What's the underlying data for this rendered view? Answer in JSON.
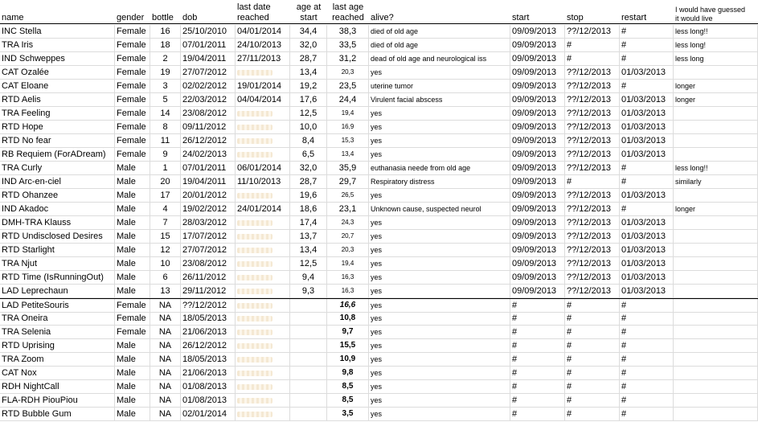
{
  "columns": {
    "name": "name",
    "gender": "gender",
    "bottle": "bottle",
    "dob": "dob",
    "last_date": "last date\nreached",
    "age_start": "age at\nstart",
    "last_age": "last age\nreached",
    "alive": "alive?",
    "start": "start",
    "stop": "stop",
    "restart": "restart",
    "guess": "I would have guessed\nit would live"
  },
  "rows": [
    {
      "name": "INC Stella",
      "gender": "Female",
      "bottle": "16",
      "dob": "25/10/2010",
      "last_date": "04/01/2014",
      "age_start": "34,4",
      "last_age": "38,3",
      "alive": "died of old age",
      "start": "09/09/2013",
      "stop": "??/12/2013",
      "restart": "#",
      "guess": "less long!!"
    },
    {
      "name": "TRA Iris",
      "gender": "Female",
      "bottle": "18",
      "dob": "07/01/2011",
      "last_date": "24/10/2013",
      "age_start": "32,0",
      "last_age": "33,5",
      "alive": "died of old age",
      "start": "09/09/2013",
      "stop": "#",
      "restart": "#",
      "guess": "less long!"
    },
    {
      "name": "IND Schweppes",
      "gender": "Female",
      "bottle": "2",
      "dob": "19/04/2011",
      "last_date": "27/11/2013",
      "age_start": "28,7",
      "last_age": "31,2",
      "alive": "dead of old age and neurological iss",
      "start": "09/09/2013",
      "stop": "#",
      "restart": "#",
      "guess": "less long"
    },
    {
      "name": "CAT Ozalée",
      "gender": "Female",
      "bottle": "19",
      "dob": "27/07/2012",
      "last_date": "",
      "age_start": "13,4",
      "last_age": "20,3",
      "alive": "yes",
      "start": "09/09/2013",
      "stop": "??/12/2013",
      "restart": "01/03/2013",
      "guess": ""
    },
    {
      "name": "CAT Eloane",
      "gender": "Female",
      "bottle": "3",
      "dob": "02/02/2012",
      "last_date": "19/01/2014",
      "age_start": "19,2",
      "last_age": "23,5",
      "alive": "uterine tumor",
      "start": "09/09/2013",
      "stop": "??/12/2013",
      "restart": "#",
      "guess": "longer"
    },
    {
      "name": "RTD Aelis",
      "gender": "Female",
      "bottle": "5",
      "dob": "22/03/2012",
      "last_date": "04/04/2014",
      "age_start": "17,6",
      "last_age": "24,4",
      "alive": "Virulent facial abscess",
      "start": "09/09/2013",
      "stop": "??/12/2013",
      "restart": "01/03/2013",
      "guess": "longer"
    },
    {
      "name": "TRA Feeling",
      "gender": "Female",
      "bottle": "14",
      "dob": "23/08/2012",
      "last_date": "",
      "age_start": "12,5",
      "last_age": "19,4",
      "alive": "yes",
      "start": "09/09/2013",
      "stop": "??/12/2013",
      "restart": "01/03/2013",
      "guess": ""
    },
    {
      "name": "RTD Hope",
      "gender": "Female",
      "bottle": "8",
      "dob": "09/11/2012",
      "last_date": "",
      "age_start": "10,0",
      "last_age": "16,9",
      "alive": "yes",
      "start": "09/09/2013",
      "stop": "??/12/2013",
      "restart": "01/03/2013",
      "guess": ""
    },
    {
      "name": "RTD No fear",
      "gender": "Female",
      "bottle": "11",
      "dob": "26/12/2012",
      "last_date": "",
      "age_start": "8,4",
      "last_age": "15,3",
      "alive": "yes",
      "start": "09/09/2013",
      "stop": "??/12/2013",
      "restart": "01/03/2013",
      "guess": ""
    },
    {
      "name": "RB Requiem (ForADream)",
      "gender": "Female",
      "bottle": "9",
      "dob": "24/02/2013",
      "last_date": "",
      "age_start": "6,5",
      "last_age": "13,4",
      "alive": "yes",
      "start": "09/09/2013",
      "stop": "??/12/2013",
      "restart": "01/03/2013",
      "guess": ""
    },
    {
      "name": "TRA Curly",
      "gender": "Male",
      "bottle": "1",
      "dob": "07/01/2011",
      "last_date": "06/01/2014",
      "age_start": "32,0",
      "last_age": "35,9",
      "alive": "euthanasia neede from old age",
      "start": "09/09/2013",
      "stop": "??/12/2013",
      "restart": "#",
      "guess": "less long!!"
    },
    {
      "name": "IND Arc-en-ciel",
      "gender": "Male",
      "bottle": "20",
      "dob": "19/04/2011",
      "last_date": "11/10/2013",
      "age_start": "28,7",
      "last_age": "29,7",
      "alive": "Respiratory distress",
      "start": "09/09/2013",
      "stop": "#",
      "restart": "#",
      "guess": "similarly"
    },
    {
      "name": "RTD Ohanzee",
      "gender": "Male",
      "bottle": "17",
      "dob": "20/01/2012",
      "last_date": "",
      "age_start": "19,6",
      "last_age": "26,5",
      "alive": "yes",
      "start": "09/09/2013",
      "stop": "??/12/2013",
      "restart": "01/03/2013",
      "guess": ""
    },
    {
      "name": "IND Akadoc",
      "gender": "Male",
      "bottle": "4",
      "dob": "19/02/2012",
      "last_date": "24/01/2014",
      "age_start": "18,6",
      "last_age": "23,1",
      "alive": "Unknown cause, suspected neurol",
      "start": "09/09/2013",
      "stop": "??/12/2013",
      "restart": "#",
      "guess": "longer"
    },
    {
      "name": "DMH-TRA Klauss",
      "gender": "Male",
      "bottle": "7",
      "dob": "28/03/2012",
      "last_date": "",
      "age_start": "17,4",
      "last_age": "24,3",
      "alive": "yes",
      "start": "09/09/2013",
      "stop": "??/12/2013",
      "restart": "01/03/2013",
      "guess": ""
    },
    {
      "name": "RTD Undisclosed Desires",
      "gender": "Male",
      "bottle": "15",
      "dob": "17/07/2012",
      "last_date": "",
      "age_start": "13,7",
      "last_age": "20,7",
      "alive": "yes",
      "start": "09/09/2013",
      "stop": "??/12/2013",
      "restart": "01/03/2013",
      "guess": ""
    },
    {
      "name": "RTD Starlight",
      "gender": "Male",
      "bottle": "12",
      "dob": "27/07/2012",
      "last_date": "",
      "age_start": "13,4",
      "last_age": "20,3",
      "alive": "yes",
      "start": "09/09/2013",
      "stop": "??/12/2013",
      "restart": "01/03/2013",
      "guess": ""
    },
    {
      "name": "TRA Njut",
      "gender": "Male",
      "bottle": "10",
      "dob": "23/08/2012",
      "last_date": "",
      "age_start": "12,5",
      "last_age": "19,4",
      "alive": "yes",
      "start": "09/09/2013",
      "stop": "??/12/2013",
      "restart": "01/03/2013",
      "guess": ""
    },
    {
      "name": "RTD Time (IsRunningOut)",
      "gender": "Male",
      "bottle": "6",
      "dob": "26/11/2012",
      "last_date": "",
      "age_start": "9,4",
      "last_age": "16,3",
      "alive": "yes",
      "start": "09/09/2013",
      "stop": "??/12/2013",
      "restart": "01/03/2013",
      "guess": ""
    },
    {
      "name": "LAD Leprechaun",
      "gender": "Male",
      "bottle": "13",
      "dob": "29/11/2012",
      "last_date": "",
      "age_start": "9,3",
      "last_age": "16,3",
      "alive": "yes",
      "start": "09/09/2013",
      "stop": "??/12/2013",
      "restart": "01/03/2013",
      "guess": ""
    },
    {
      "name": "LAD PetiteSouris",
      "gender": "Female",
      "bottle": "NA",
      "dob": "??/12/2012",
      "last_date": "",
      "age_start": "",
      "last_age": "16,6",
      "alive": "yes",
      "start": "#",
      "stop": "#",
      "restart": "#",
      "guess": ""
    },
    {
      "name": "TRA Oneira",
      "gender": "Female",
      "bottle": "NA",
      "dob": "18/05/2013",
      "last_date": "",
      "age_start": "",
      "last_age": "10,8",
      "alive": "yes",
      "start": "#",
      "stop": "#",
      "restart": "#",
      "guess": ""
    },
    {
      "name": "TRA Selenia",
      "gender": "Female",
      "bottle": "NA",
      "dob": "21/06/2013",
      "last_date": "",
      "age_start": "",
      "last_age": "9,7",
      "alive": "yes",
      "start": "#",
      "stop": "#",
      "restart": "#",
      "guess": ""
    },
    {
      "name": "RTD Uprising",
      "gender": "Male",
      "bottle": "NA",
      "dob": "26/12/2012",
      "last_date": "",
      "age_start": "",
      "last_age": "15,5",
      "alive": "yes",
      "start": "#",
      "stop": "#",
      "restart": "#",
      "guess": ""
    },
    {
      "name": "TRA Zoom",
      "gender": "Male",
      "bottle": "NA",
      "dob": "18/05/2013",
      "last_date": "",
      "age_start": "",
      "last_age": "10,9",
      "alive": "yes",
      "start": "#",
      "stop": "#",
      "restart": "#",
      "guess": ""
    },
    {
      "name": "CAT Nox",
      "gender": "Male",
      "bottle": "NA",
      "dob": "21/06/2013",
      "last_date": "",
      "age_start": "",
      "last_age": "9,8",
      "alive": "yes",
      "start": "#",
      "stop": "#",
      "restart": "#",
      "guess": ""
    },
    {
      "name": "RDH NightCall",
      "gender": "Male",
      "bottle": "NA",
      "dob": "01/08/2013",
      "last_date": "",
      "age_start": "",
      "last_age": "8,5",
      "alive": "yes",
      "start": "#",
      "stop": "#",
      "restart": "#",
      "guess": ""
    },
    {
      "name": "FLA-RDH PiouPiou",
      "gender": "Male",
      "bottle": "NA",
      "dob": "01/08/2013",
      "last_date": "",
      "age_start": "",
      "last_age": "8,5",
      "alive": "yes",
      "start": "#",
      "stop": "#",
      "restart": "#",
      "guess": ""
    },
    {
      "name": "RTD Bubble Gum",
      "gender": "Male",
      "bottle": "NA",
      "dob": "02/01/2014",
      "last_date": "",
      "age_start": "",
      "last_age": "3,5",
      "alive": "yes",
      "start": "#",
      "stop": "#",
      "restart": "#",
      "guess": ""
    }
  ]
}
